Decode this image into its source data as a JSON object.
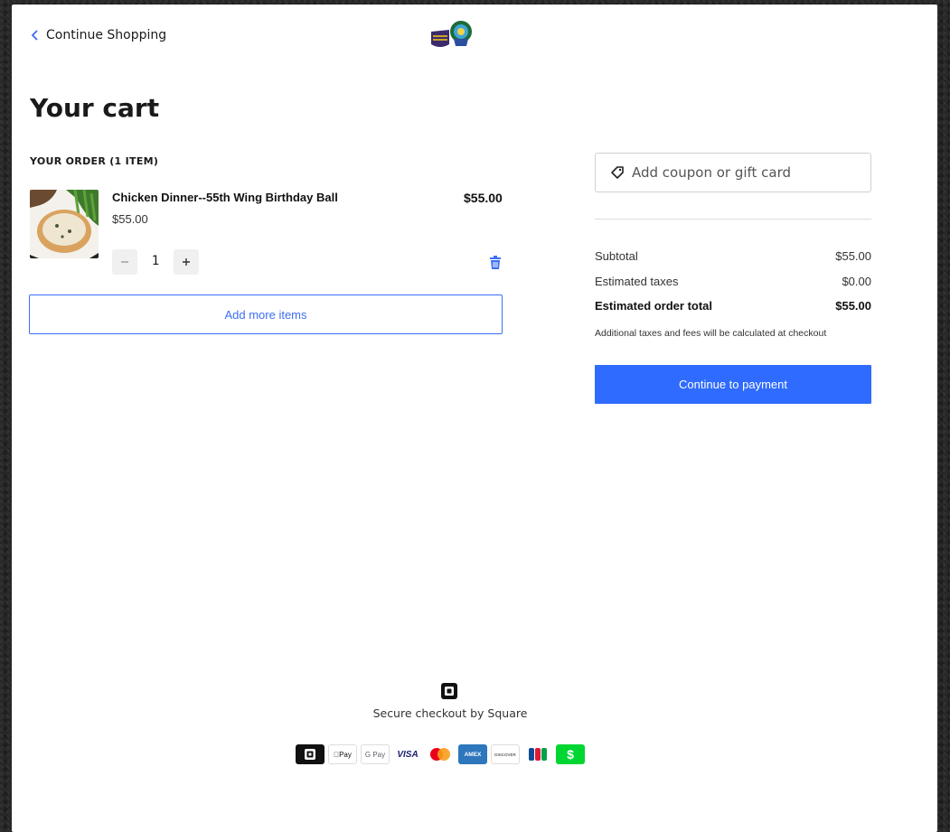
{
  "header": {
    "back_label": "Continue Shopping"
  },
  "page_title": "Your cart",
  "order": {
    "heading": "YOUR ORDER (1 ITEM)",
    "items": [
      {
        "name": "Chicken Dinner--55th Wing Birthday Ball",
        "unit_price": "$55.00",
        "total": "$55.00",
        "quantity": "1"
      }
    ],
    "add_more_label": "Add more items"
  },
  "summary": {
    "coupon_placeholder": "Add coupon or gift card",
    "subtotal_label": "Subtotal",
    "subtotal_value": "$55.00",
    "taxes_label": "Estimated taxes",
    "taxes_value": "$0.00",
    "total_label": "Estimated order total",
    "total_value": "$55.00",
    "note": "Additional taxes and fees will be calculated at checkout",
    "pay_button": "Continue to payment"
  },
  "footer": {
    "secure_text": "Secure checkout by Square",
    "payment_methods": [
      {
        "icon": "square-icon"
      },
      {
        "icon": "apple-pay-icon",
        "label": "Pay"
      },
      {
        "icon": "google-pay-icon",
        "label": "G Pay"
      },
      {
        "icon": "visa-icon",
        "label": "VISA"
      },
      {
        "icon": "mastercard-icon"
      },
      {
        "icon": "amex-icon",
        "label": "AMEX"
      },
      {
        "icon": "discover-icon",
        "label": "DISCOVER"
      },
      {
        "icon": "jcb-icon",
        "label": "JCB"
      },
      {
        "icon": "cash-app-icon",
        "label": "$"
      }
    ]
  },
  "colors": {
    "accent": "#2f6bff",
    "link": "#3d6ef5",
    "backdrop": "#262626"
  }
}
